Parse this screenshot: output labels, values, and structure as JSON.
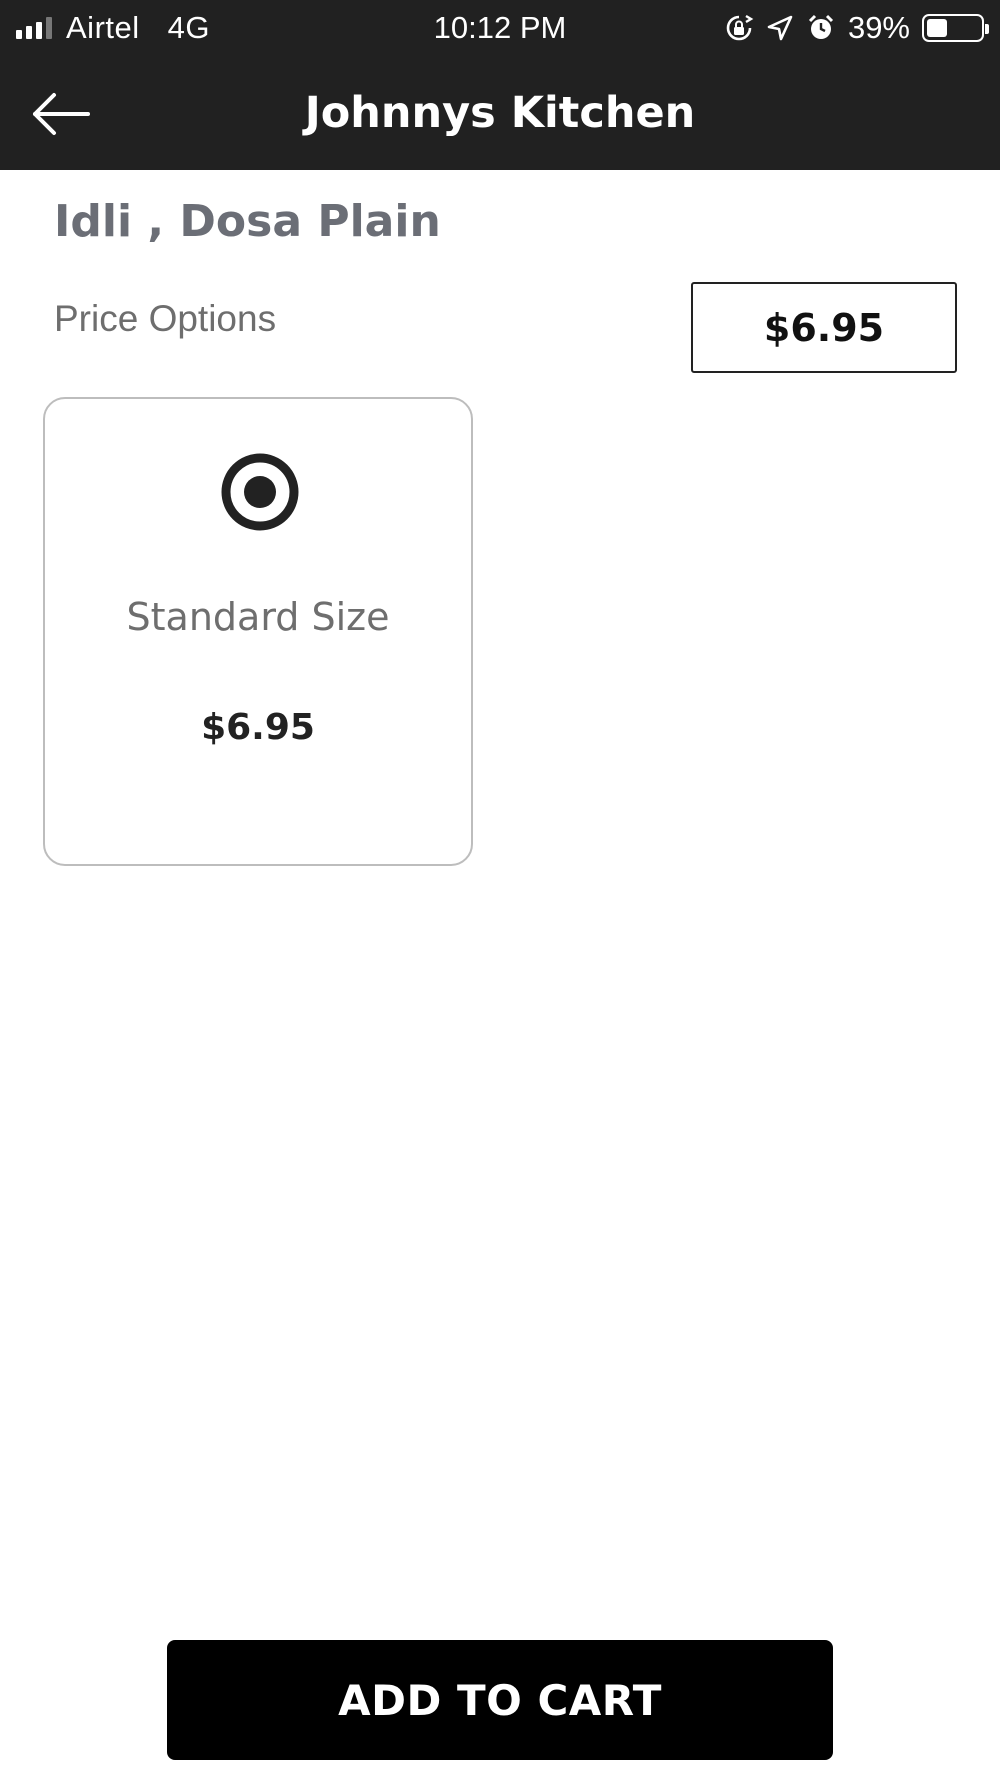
{
  "status_bar": {
    "carrier": "Airtel",
    "network": "4G",
    "time": "10:12 PM",
    "battery_percent": "39%",
    "battery_level": 0.39,
    "signal_bars_filled": 3,
    "icons": [
      "orientation-lock-icon",
      "location-arrow-icon",
      "alarm-clock-icon",
      "battery-icon"
    ]
  },
  "header": {
    "back_icon": "arrow-left-icon",
    "title": "Johnnys Kitchen"
  },
  "item": {
    "name": "Idli , Dosa Plain",
    "price_options_label": "Price Options",
    "selected_price": "$6.95",
    "options": [
      {
        "name": "Standard Size",
        "price": "$6.95",
        "selected": true,
        "icon": "radio-selected-icon"
      }
    ]
  },
  "actions": {
    "add_to_cart_label": "ADD TO CART"
  },
  "colors": {
    "header_bg": "#212121",
    "button_bg": "#000000",
    "title_text": "#6b6e76"
  }
}
